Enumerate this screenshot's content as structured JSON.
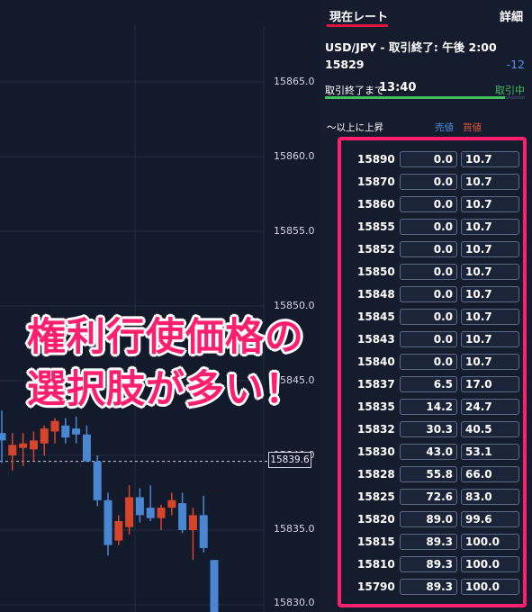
{
  "chart": {
    "price_labels": [
      "15865.0",
      "15860.0",
      "15855.0",
      "15850.0",
      "15845.0",
      "15840.0",
      "15835.0",
      "15830.0"
    ],
    "current_price": "15839.6",
    "overlay_line1": "権利行使価格の",
    "overlay_line2": "選択肢が多い！",
    "colors": {
      "up": "#d6452b",
      "down": "#4a87d2",
      "background": "#131a2b"
    }
  },
  "tabs": {
    "current_rate": "現在レート",
    "details": "詳細"
  },
  "info": {
    "title": "USD/JPY - 取引終了: 午後 2:00",
    "price": "15829",
    "change": "-12",
    "close_label": "取引終了まで",
    "close_time": "13:40",
    "status": "取引中",
    "progress": 0.9
  },
  "columns": {
    "condition": "〜以上に上昇",
    "sell": "売値",
    "buy": "買値"
  },
  "options": [
    {
      "strike": "15890",
      "sell": "0.0",
      "buy": "10.7"
    },
    {
      "strike": "15870",
      "sell": "0.0",
      "buy": "10.7"
    },
    {
      "strike": "15860",
      "sell": "0.0",
      "buy": "10.7"
    },
    {
      "strike": "15855",
      "sell": "0.0",
      "buy": "10.7"
    },
    {
      "strike": "15852",
      "sell": "0.0",
      "buy": "10.7"
    },
    {
      "strike": "15850",
      "sell": "0.0",
      "buy": "10.7"
    },
    {
      "strike": "15848",
      "sell": "0.0",
      "buy": "10.7"
    },
    {
      "strike": "15845",
      "sell": "0.0",
      "buy": "10.7"
    },
    {
      "strike": "15843",
      "sell": "0.0",
      "buy": "10.7"
    },
    {
      "strike": "15840",
      "sell": "0.0",
      "buy": "10.7"
    },
    {
      "strike": "15837",
      "sell": "6.5",
      "buy": "17.0"
    },
    {
      "strike": "15835",
      "sell": "14.2",
      "buy": "24.7"
    },
    {
      "strike": "15832",
      "sell": "30.3",
      "buy": "40.5"
    },
    {
      "strike": "15830",
      "sell": "43.0",
      "buy": "53.1"
    },
    {
      "strike": "15828",
      "sell": "55.8",
      "buy": "66.0"
    },
    {
      "strike": "15825",
      "sell": "72.6",
      "buy": "83.0"
    },
    {
      "strike": "15820",
      "sell": "89.0",
      "buy": "99.6"
    },
    {
      "strike": "15815",
      "sell": "89.3",
      "buy": "100.0"
    },
    {
      "strike": "15810",
      "sell": "89.3",
      "buy": "100.0"
    },
    {
      "strike": "15790",
      "sell": "89.3",
      "buy": "100.0"
    }
  ],
  "candles": [
    {
      "o": 15841.5,
      "h": 15843.0,
      "l": 15839.5,
      "c": 15841.0
    },
    {
      "o": 15840.0,
      "h": 15841.5,
      "l": 15839.0,
      "c": 15840.7
    },
    {
      "o": 15840.5,
      "h": 15841.5,
      "l": 15839.3,
      "c": 15840.8
    },
    {
      "o": 15840.4,
      "h": 15841.6,
      "l": 15839.6,
      "c": 15841.0
    },
    {
      "o": 15840.8,
      "h": 15842.0,
      "l": 15840.0,
      "c": 15841.8
    },
    {
      "o": 15841.6,
      "h": 15842.5,
      "l": 15840.8,
      "c": 15842.3
    },
    {
      "o": 15842.0,
      "h": 15842.5,
      "l": 15840.8,
      "c": 15841.2
    },
    {
      "o": 15841.8,
      "h": 15842.6,
      "l": 15840.8,
      "c": 15841.4
    },
    {
      "o": 15841.4,
      "h": 15842.0,
      "l": 15839.6,
      "c": 15839.6
    },
    {
      "o": 15839.6,
      "h": 15840.0,
      "l": 15836.6,
      "c": 15837.0
    },
    {
      "o": 15837.0,
      "h": 15837.5,
      "l": 15833.3,
      "c": 15834.0
    },
    {
      "o": 15834.3,
      "h": 15836.0,
      "l": 15834.0,
      "c": 15835.6
    },
    {
      "o": 15835.2,
      "h": 15838.0,
      "l": 15834.7,
      "c": 15837.2
    },
    {
      "o": 15837.2,
      "h": 15837.8,
      "l": 15835.5,
      "c": 15836.0
    },
    {
      "o": 15836.5,
      "h": 15838.0,
      "l": 15835.6,
      "c": 15835.8
    },
    {
      "o": 15835.8,
      "h": 15836.7,
      "l": 15835.0,
      "c": 15836.5
    },
    {
      "o": 15836.5,
      "h": 15837.5,
      "l": 15836.0,
      "c": 15837.0
    },
    {
      "o": 15836.8,
      "h": 15837.5,
      "l": 15834.8,
      "c": 15835.0
    },
    {
      "o": 15835.0,
      "h": 15836.5,
      "l": 15833.0,
      "c": 15836.0
    },
    {
      "o": 15836.0,
      "h": 15837.3,
      "l": 15833.5,
      "c": 15833.8
    },
    {
      "o": 15833.0,
      "h": 15833.0,
      "l": 15828.0,
      "c": 15829.0
    }
  ]
}
